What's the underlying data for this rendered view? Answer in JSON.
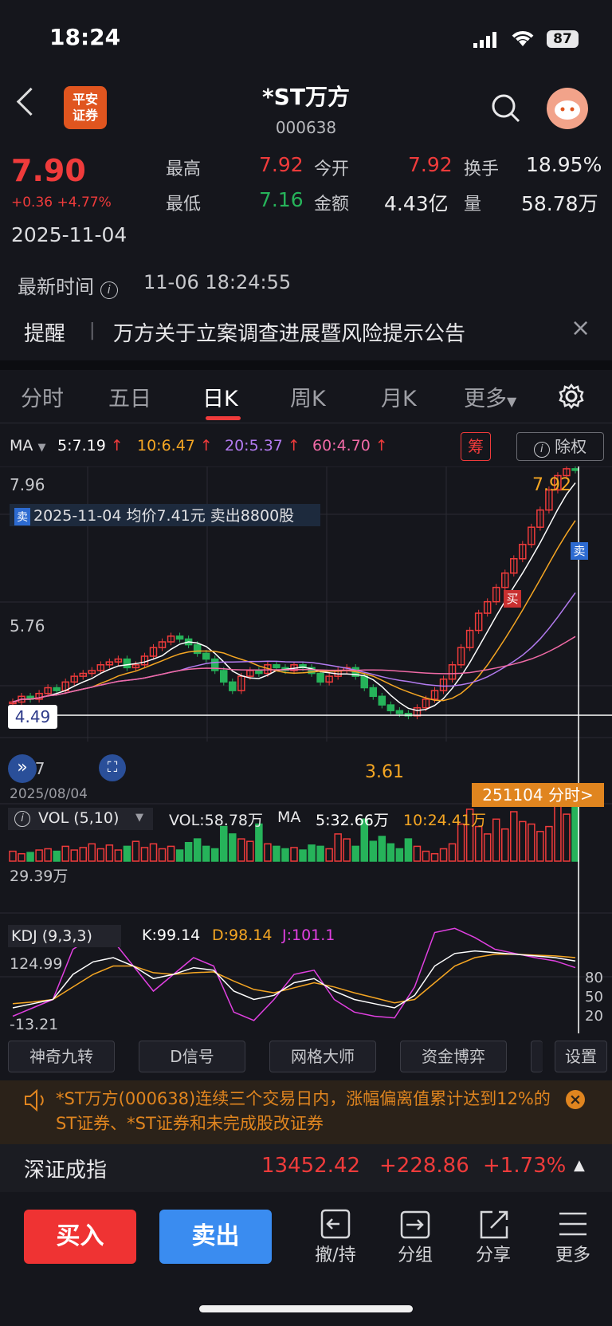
{
  "status_bar": {
    "time": "18:24",
    "battery": "87"
  },
  "header": {
    "logo_text": "平安\n证券",
    "title": "*ST万方",
    "code": "000638"
  },
  "quote": {
    "price": "7.90",
    "change": "+0.36 +4.77%",
    "date": "2025-11-04",
    "high_label": "最高",
    "high": "7.92",
    "low_label": "最低",
    "low": "7.16",
    "open_label": "今开",
    "open": "7.92",
    "amount_label": "金额",
    "amount": "4.43亿",
    "turnover_label": "换手",
    "turnover": "18.95%",
    "volume_label": "量",
    "volume": "58.78万",
    "latest_time_label": "最新时间",
    "latest_time": "11-06 18:24:55"
  },
  "alert": {
    "label": "提醒",
    "text": "万方关于立案调查进展暨风险提示公告"
  },
  "tabs": [
    "分时",
    "五日",
    "日K",
    "周K",
    "月K",
    "更多"
  ],
  "active_tab": "日K",
  "kline": {
    "ma_label": "MA",
    "ma5": "5:7.19",
    "ma10": "10:6.47",
    "ma20": "20:5.37",
    "ma60": "60:4.70",
    "chip_button": "筹",
    "rights_button": "除权",
    "y_top": "7.96",
    "y_mid": "5.76",
    "y_cursor": "4.49",
    "y_bottom": "3.37",
    "trade_note": "2025-11-04 均价7.41元 卖出8800股",
    "trade_tag": "卖",
    "high_mark": "7.92",
    "low_mark": "3.61",
    "buy_mark": "买",
    "sell_mark": "卖",
    "start_date": "2025/08/04",
    "cursor_date_btn": "251104 分时>",
    "colors": {
      "ma5": "#ffffff",
      "ma10": "#f5a623",
      "ma20": "#b37bf0",
      "ma60": "#f06aa6"
    }
  },
  "volume_panel": {
    "title": "VOL (5,10)",
    "vol": "VOL:58.78万",
    "ma_label": "MA",
    "ma5": "5:32.66万",
    "ma10": "10:24.41万",
    "y_label": "29.39万"
  },
  "kdj_panel": {
    "title": "KDJ (9,3,3)",
    "k": "K:99.14",
    "d": "D:98.14",
    "j": "J:101.1",
    "y_top": "124.99",
    "y_bottom": "-13.21",
    "level80": "80",
    "level50": "50",
    "level20": "20"
  },
  "function_buttons": [
    "神奇九转",
    "D信号",
    "网格大师",
    "资金博弈",
    "设置"
  ],
  "notice": {
    "text": "*ST万方(000638)连续三个交易日内，涨幅偏离值累计达到12%的ST证券、*ST证券和未完成股改证券"
  },
  "index": {
    "name": "深证成指",
    "value": "13452.42",
    "change": "+228.86",
    "pct": "+1.73%"
  },
  "bottom_nav": {
    "buy": "买入",
    "sell": "卖出",
    "items": [
      {
        "label": "撤/持",
        "icon": "withdraw-icon"
      },
      {
        "label": "分组",
        "icon": "group-icon"
      },
      {
        "label": "分享",
        "icon": "share-icon"
      },
      {
        "label": "更多",
        "icon": "menu-icon"
      }
    ]
  }
}
